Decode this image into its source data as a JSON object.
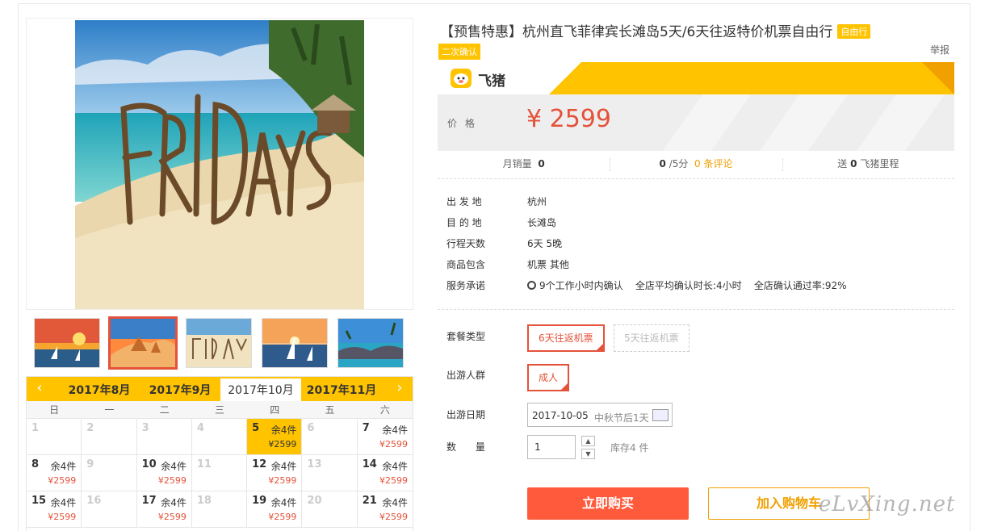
{
  "product": {
    "title": "【预售特惠】杭州直飞菲律宾长滩岛5天/6天往返特价机票自由行",
    "tag": "自由行",
    "confirm_tag": "二次确认",
    "report": "举报"
  },
  "brand": {
    "logo_text": "飞猪",
    "accent": "#ffc300"
  },
  "price": {
    "label": "价格",
    "value": "¥ 2599"
  },
  "stats": {
    "monthly_label": "月销量",
    "monthly_value": "0",
    "rating_value": "0",
    "rating_suffix": "/5分",
    "reviews": "0 条评论",
    "gift_prefix": "送",
    "gift_value": "0",
    "gift_suffix": "飞猪里程"
  },
  "info": [
    {
      "k": "出 发 地",
      "v": "杭州"
    },
    {
      "k": "目 的 地",
      "v": "长滩岛"
    },
    {
      "k": "行程天数",
      "v": "6天 5晚"
    },
    {
      "k": "商品包含",
      "v": "机票  其他"
    }
  ],
  "service": {
    "k": "服务承诺",
    "items": [
      "9个工作小时内确认",
      "全店平均确认时长:4小时",
      "全店确认通过率:92%"
    ]
  },
  "options": {
    "package_label": "套餐类型",
    "package_selected": "6天往返机票",
    "package_other": "5天往返机票",
    "crowd_label": "出游人群",
    "crowd_selected": "成人",
    "date_label": "出游日期",
    "date_value": "2017-10-05",
    "date_hint": "中秋节后1天",
    "qty_label": "数 量",
    "qty_value": "1",
    "stock": "库存4 件"
  },
  "actions": {
    "buy": "立即购买",
    "cart": "加入购物车"
  },
  "watermark": "eLvXing.net",
  "calendar": {
    "prev": "‹",
    "next": "›",
    "months": [
      "2017年8月",
      "2017年9月",
      "2017年10月",
      "2017年11月"
    ],
    "active_month": 2,
    "weekdays": [
      "日",
      "一",
      "二",
      "三",
      "四",
      "五",
      "六"
    ],
    "cells": [
      {
        "d": "1"
      },
      {
        "d": "2"
      },
      {
        "d": "3"
      },
      {
        "d": "4"
      },
      {
        "d": "5",
        "stock": "余4件",
        "price": "¥2599",
        "selected": true
      },
      {
        "d": "6"
      },
      {
        "d": "7",
        "stock": "余4件",
        "price": "¥2599"
      },
      {
        "d": "8",
        "stock": "余4件",
        "price": "¥2599"
      },
      {
        "d": "9"
      },
      {
        "d": "10",
        "stock": "余4件",
        "price": "¥2599"
      },
      {
        "d": "11"
      },
      {
        "d": "12",
        "stock": "余4件",
        "price": "¥2599"
      },
      {
        "d": "13"
      },
      {
        "d": "14",
        "stock": "余4件",
        "price": "¥2599"
      },
      {
        "d": "15",
        "stock": "余4件",
        "price": "¥2599"
      },
      {
        "d": "16"
      },
      {
        "d": "17",
        "stock": "余4件",
        "price": "¥2599"
      },
      {
        "d": "18"
      },
      {
        "d": "19",
        "stock": "余4件",
        "price": "¥2599"
      },
      {
        "d": "20"
      },
      {
        "d": "21",
        "stock": "余4件",
        "price": "¥2599"
      }
    ]
  }
}
